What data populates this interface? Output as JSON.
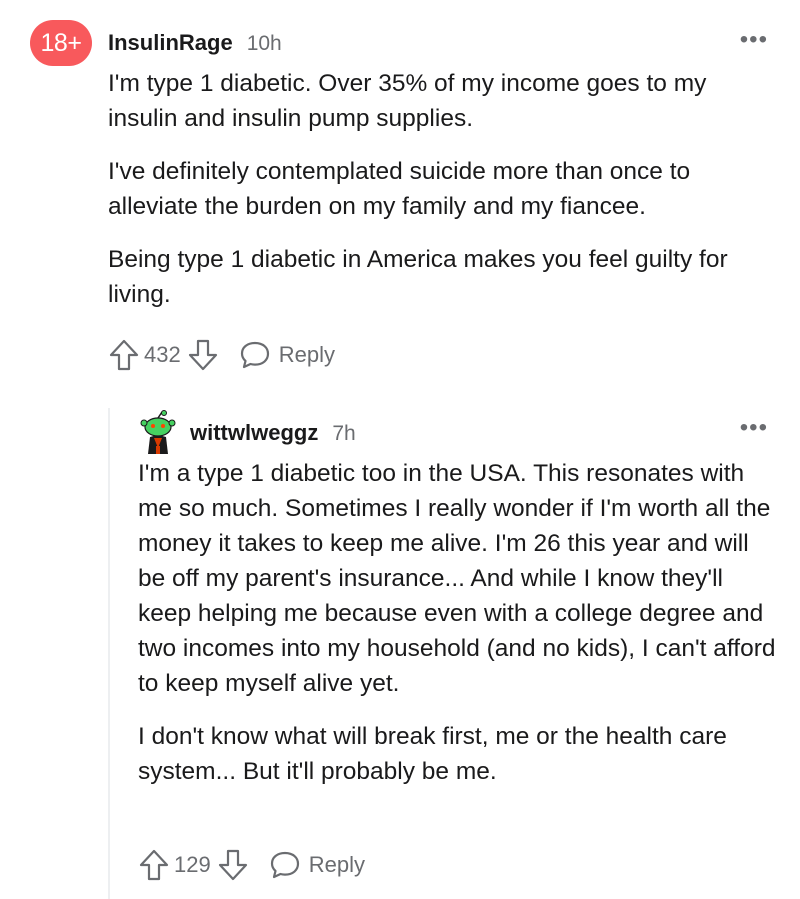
{
  "comments": [
    {
      "avatar_text": "18+",
      "username": "InsulinRage",
      "time": "10h",
      "more": "•••",
      "paragraphs": [
        "I'm type 1 diabetic. Over 35% of my income goes to my insulin and insulin pump supplies.",
        "I've definitely contemplated suicide more than once to alleviate the burden on my family and my fiancee.",
        "Being type 1 diabetic in America makes you feel guilty for living."
      ],
      "score": "432",
      "reply_label": "Reply"
    },
    {
      "avatar_icon": "snoo-avatar-icon",
      "username": "wittwlweggz",
      "time": "7h",
      "more": "•••",
      "paragraphs": [
        "I'm a type 1 diabetic too in the USA. This resonates with me so much. Sometimes I really wonder if I'm worth all the money it takes to keep me alive. I'm 26 this year and will be off my parent's insurance... And while I know they'll keep helping me because even with a college degree and two incomes into my household (and no kids), I can't afford to keep myself alive yet.",
        "I don't know what will break first, me or the health care system... But it'll probably be me."
      ],
      "score": "129",
      "reply_label": "Reply"
    }
  ],
  "colors": {
    "avatar_badge": "#f8595c",
    "muted_text": "#6a6c70",
    "body_text": "#1a1a1b",
    "thread_line": "#edeff1"
  },
  "icons": [
    "upvote-icon",
    "downvote-icon",
    "reply-icon",
    "more-options-icon",
    "snoo-avatar-icon"
  ]
}
